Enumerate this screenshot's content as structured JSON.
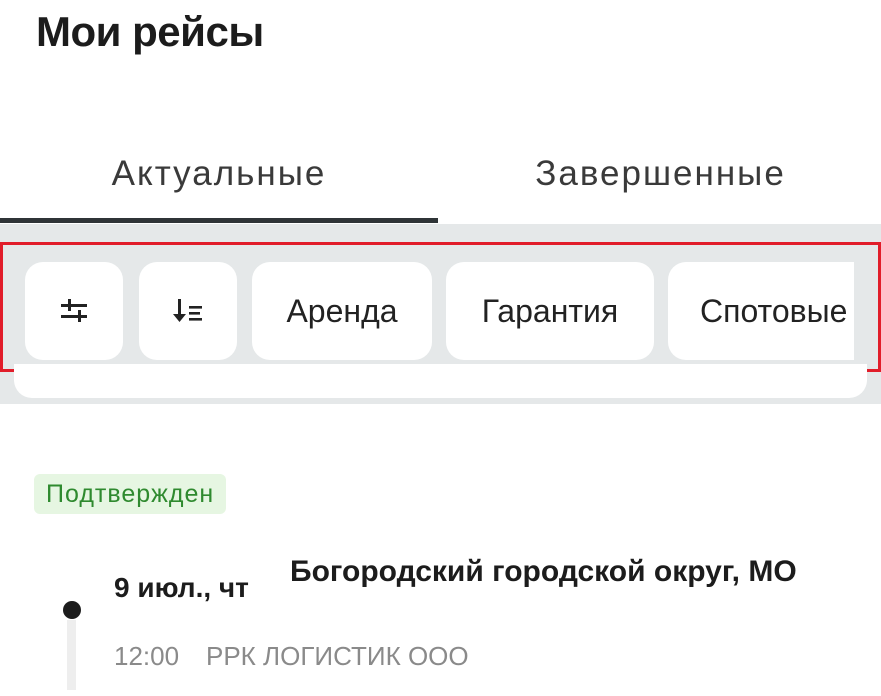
{
  "header": {
    "title": "Мои рейсы"
  },
  "tabs": [
    {
      "label": "Актуальные",
      "active": true
    },
    {
      "label": "Завершенные",
      "active": false
    }
  ],
  "filters": {
    "icons": [
      "filter-sliders-icon",
      "sort-descending-icon"
    ],
    "chips": [
      "Аренда",
      "Гарантия",
      "Спотовые"
    ]
  },
  "trip": {
    "status": "Подтвержден",
    "date": "9 июл., чт",
    "place": "Богородский городской округ, МО",
    "time": "12:00",
    "company": "РРК ЛОГИСТИК ООО"
  },
  "colors": {
    "status_text": "#2f8a2f",
    "status_bg": "#e6f6e2",
    "highlight_border": "#e11d2a",
    "filter_bg": "#e5e8e9"
  }
}
